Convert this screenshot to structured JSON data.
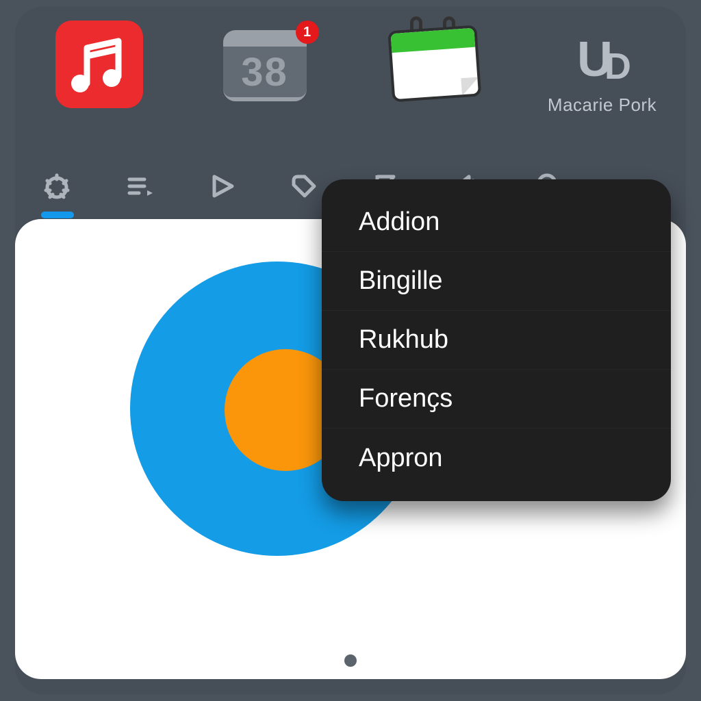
{
  "apps": {
    "music": {
      "name": "music-app"
    },
    "calendar_badge": {
      "day": "38",
      "badge": "1"
    },
    "notepad": {
      "name": "notepad-calendar"
    },
    "ud": {
      "glyph_main": "U",
      "glyph_sub": "D",
      "caption": "Macarie Pork"
    }
  },
  "toolbar": {
    "items": [
      "gear",
      "playlist",
      "play",
      "tag",
      "flag",
      "volume",
      "search"
    ]
  },
  "menu": {
    "items": [
      {
        "label": "Addion"
      },
      {
        "label": "Bingille"
      },
      {
        "label": "Rukhub"
      },
      {
        "label": "Forenҫs"
      },
      {
        "label": "Appron"
      }
    ]
  },
  "chart_data": {
    "type": "pie",
    "title": "",
    "series": [
      {
        "name": "blue",
        "value": 80,
        "color": "#149ce6"
      },
      {
        "name": "orange",
        "value": 20,
        "color": "#fb960b"
      }
    ],
    "note": "concentric disc, values estimated from relative area"
  }
}
